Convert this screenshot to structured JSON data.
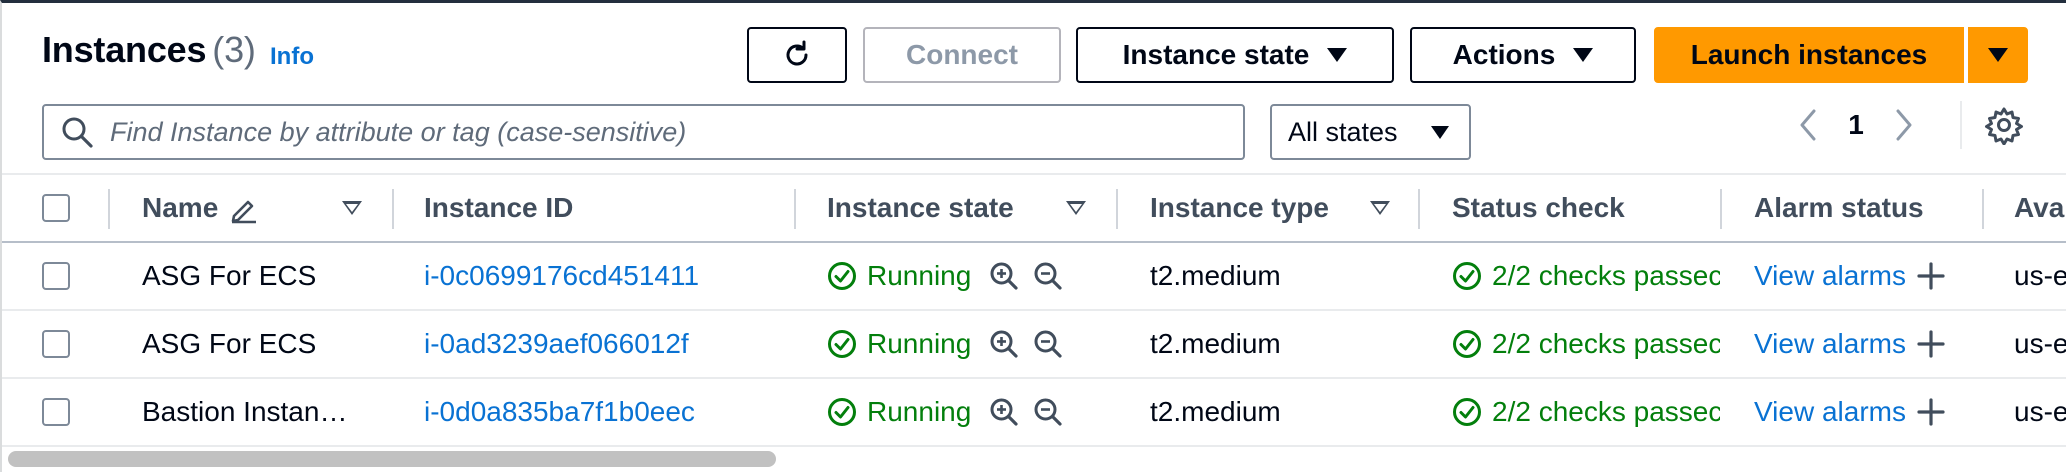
{
  "header": {
    "title": "Instances",
    "count": "(3)",
    "info_link": "Info"
  },
  "toolbar": {
    "connect_label": "Connect",
    "instance_state_label": "Instance state",
    "actions_label": "Actions",
    "launch_label": "Launch instances"
  },
  "filter": {
    "search_placeholder": "Find Instance by attribute or tag (case-sensitive)",
    "state_select_value": "All states"
  },
  "pagination": {
    "current_page": "1"
  },
  "table": {
    "columns": [
      "Name",
      "Instance ID",
      "Instance state",
      "Instance type",
      "Status check",
      "Alarm status",
      "Avai"
    ],
    "rows": [
      {
        "name": "ASG For ECS",
        "instance_id": "i-0c0699176cd451411",
        "state": "Running",
        "type": "t2.medium",
        "status_check": "2/2 checks passec",
        "alarm": "View alarms",
        "az": "us-e"
      },
      {
        "name": "ASG For ECS",
        "instance_id": "i-0ad3239aef066012f",
        "state": "Running",
        "type": "t2.medium",
        "status_check": "2/2 checks passec",
        "alarm": "View alarms",
        "az": "us-e"
      },
      {
        "name": "Bastion Instan…",
        "instance_id": "i-0d0a835ba7f1b0eec",
        "state": "Running",
        "type": "t2.medium",
        "status_check": "2/2 checks passec",
        "alarm": "View alarms",
        "az": "us-e"
      }
    ]
  },
  "colors": {
    "primary": "#ff9900",
    "link": "#0972d3",
    "success": "#037f0c",
    "text": "#000716"
  },
  "icons": {
    "refresh": "refresh-icon",
    "search": "search-icon",
    "settings": "gear-icon",
    "edit": "pencil-icon",
    "status_ok": "check-circle-icon",
    "zoom_in": "zoom-in-icon",
    "zoom_out": "zoom-out-icon",
    "add": "plus-icon"
  }
}
